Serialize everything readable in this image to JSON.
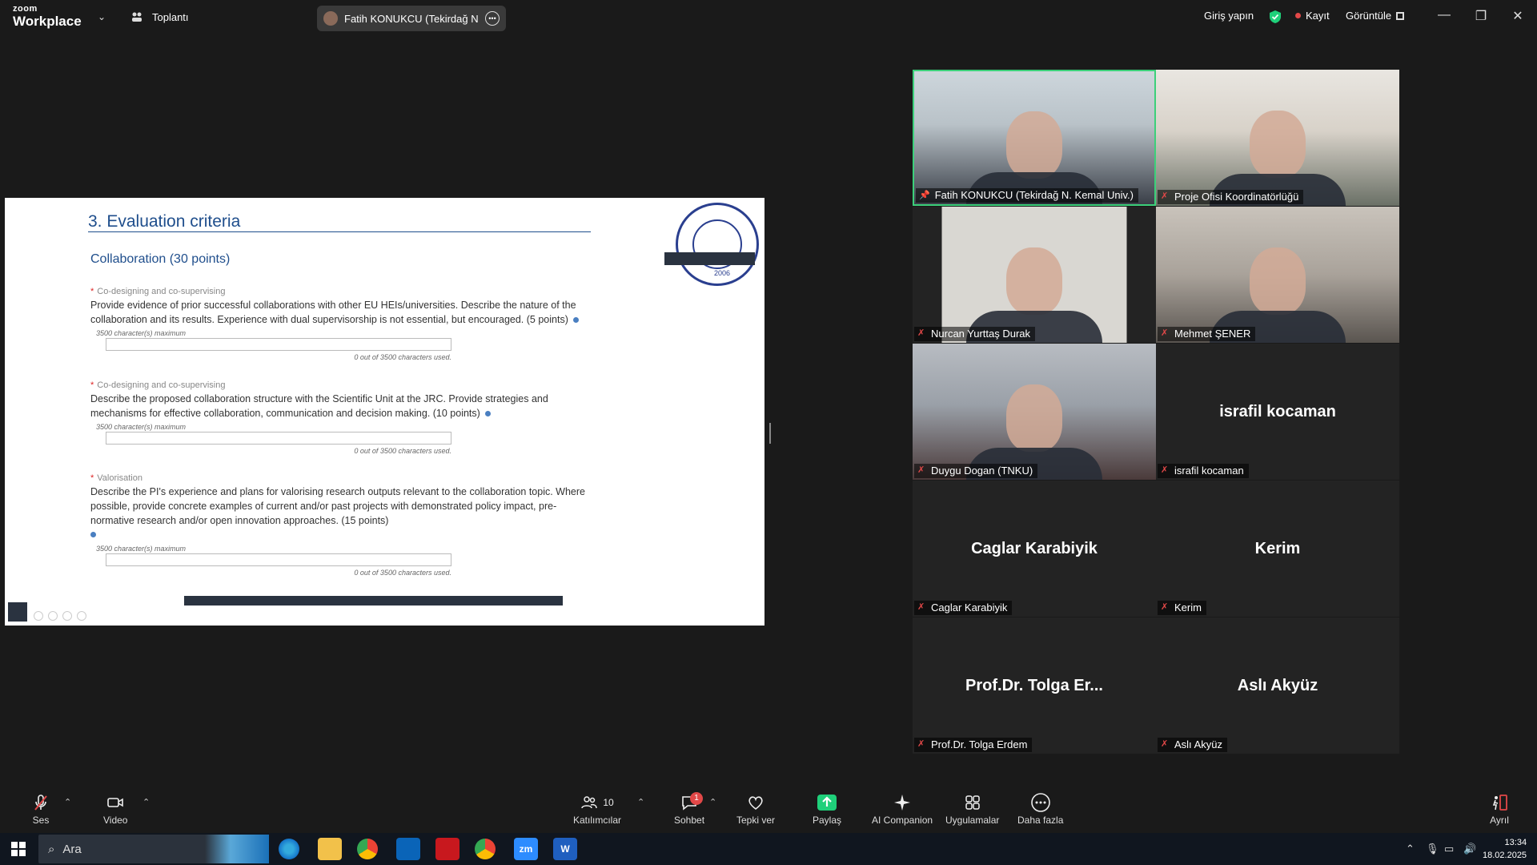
{
  "topbar": {
    "logo_small": "zoom",
    "logo_big": "Workplace",
    "meeting_label": "Toplantı",
    "active_speaker": "Fatih KONUKCU (Tekirdağ N. Ken",
    "signin": "Giriş yapın",
    "record": "Kayıt",
    "view": "Görüntüle"
  },
  "slide": {
    "title": "3. Evaluation criteria",
    "section": "Collaboration (30 points)",
    "seal_year": "2006",
    "criteria": [
      {
        "label": "Co-designing and co-supervising",
        "description": "Provide evidence of prior successful collaborations with other EU HEIs/universities. Describe the nature of the collaboration and its results. Experience with dual supervisorship is not essential, but encouraged. (5 points)",
        "max": "3500 character(s) maximum",
        "used": "0 out of 3500 characters used."
      },
      {
        "label": "Co-designing and co-supervising",
        "description": "Describe the proposed collaboration structure with the Scientific Unit at the JRC. Provide strategies and mechanisms for effective collaboration, communication and decision making. (10 points)",
        "max": "3500 character(s) maximum",
        "used": "0 out of 3500 characters used."
      },
      {
        "label": "Valorisation",
        "description": "Describe the PI's experience and plans for valorising research outputs relevant to the collaboration topic. Where possible, provide concrete examples of current and/or past projects with demonstrated policy impact, pre-normative research and/or open innovation approaches. (15 points)",
        "max": "3500 character(s) maximum",
        "used": "0 out of 3500 characters used."
      }
    ]
  },
  "participants": [
    {
      "name": "Fatih KONUKCU (Tekirdağ N. Kemal Univ.)",
      "video": true,
      "active": true,
      "pinned": true,
      "center": ""
    },
    {
      "name": "Proje Ofisi Koordinatörlüğü",
      "video": true,
      "active": false,
      "pinned": false,
      "center": ""
    },
    {
      "name": "Nurcan Yurttaş Durak",
      "video": true,
      "active": false,
      "pinned": false,
      "center": ""
    },
    {
      "name": "Mehmet ŞENER",
      "video": true,
      "active": false,
      "pinned": false,
      "center": ""
    },
    {
      "name": "Duygu Dogan (TNKU)",
      "video": true,
      "active": false,
      "pinned": false,
      "center": ""
    },
    {
      "name": "israfil kocaman",
      "video": false,
      "active": false,
      "pinned": false,
      "center": "israfil kocaman"
    },
    {
      "name": "Caglar Karabiyik",
      "video": false,
      "active": false,
      "pinned": false,
      "center": "Caglar Karabiyik"
    },
    {
      "name": "Kerim",
      "video": false,
      "active": false,
      "pinned": false,
      "center": "Kerim"
    },
    {
      "name": "Prof.Dr. Tolga Erdem",
      "video": false,
      "active": false,
      "pinned": false,
      "center": "Prof.Dr. Tolga Er..."
    },
    {
      "name": "Aslı Akyüz",
      "video": false,
      "active": false,
      "pinned": false,
      "center": "Aslı Akyüz"
    }
  ],
  "toolbar": {
    "audio": "Ses",
    "video": "Video",
    "participants": "Katılımcılar",
    "participants_count": "10",
    "chat": "Sohbet",
    "chat_badge": "1",
    "reactions": "Tepki ver",
    "share": "Paylaş",
    "ai": "AI Companion",
    "apps": "Uygulamalar",
    "more": "Daha fazla",
    "leave": "Ayrıl"
  },
  "taskbar": {
    "search": "Ara",
    "time": "13:34",
    "date": "18.02.2025",
    "zoom_app": "zm",
    "word_app": "W"
  },
  "colors": {
    "active_border": "#3cd07a",
    "share_green": "#1fd07a",
    "mute_red": "#e24848",
    "slide_blue": "#1f4e8c"
  }
}
